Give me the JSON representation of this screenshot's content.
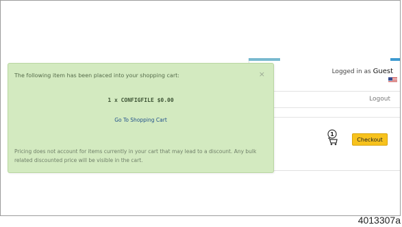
{
  "header": {
    "logged_in_prefix": "Logged in as",
    "user_name": "Guest",
    "logout_label": "Logout"
  },
  "cart": {
    "count": "1",
    "checkout_label": "Checkout"
  },
  "popup": {
    "header": "The following item has been placed into your shopping cart:",
    "close": "×",
    "item_line": "1 x CONFIGFILE $0.00",
    "go_to_cart": "Go To Shopping Cart",
    "pricing_note": "Pricing does not account for items currently in your cart that may lead to a discount. Any bulk related discounted price will be visible in the cart."
  },
  "figure_id": "4013307a",
  "colors": {
    "popup_bg": "#d3eac0",
    "checkout_bg": "#f7c21d",
    "link": "#1f4f8a"
  }
}
